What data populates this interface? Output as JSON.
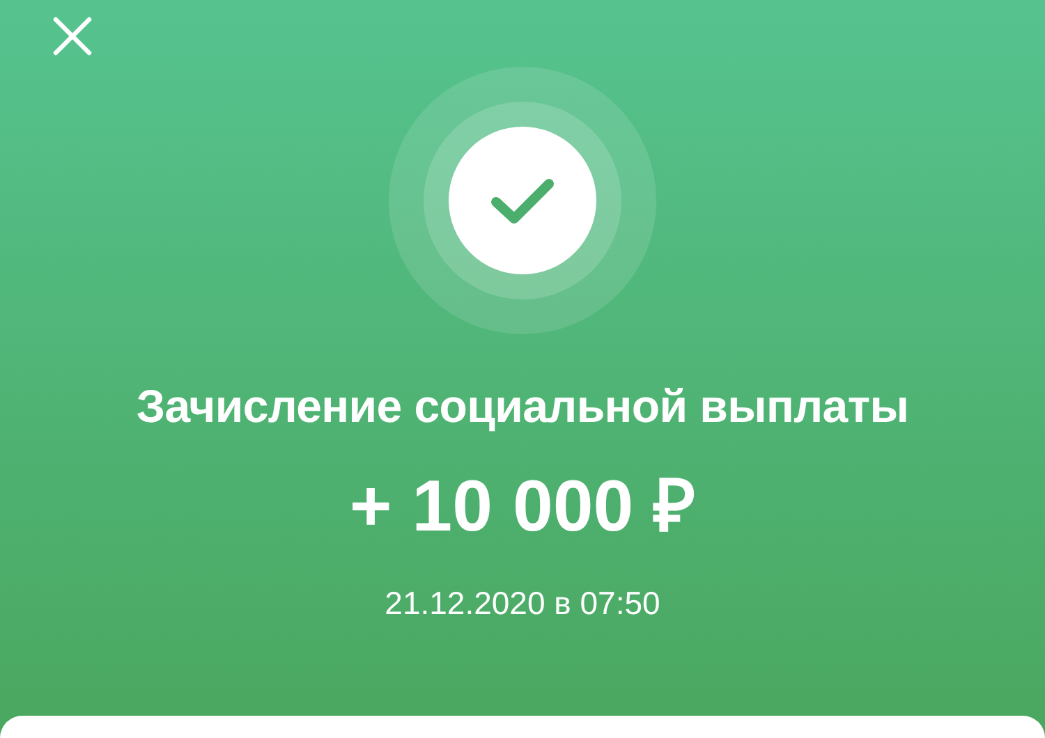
{
  "operation": {
    "succeeded": true,
    "title": "Зачисление социальной выплаты",
    "amount": "+ 10 000 ₽",
    "datetime": "21.12.2020 в 07:50"
  }
}
